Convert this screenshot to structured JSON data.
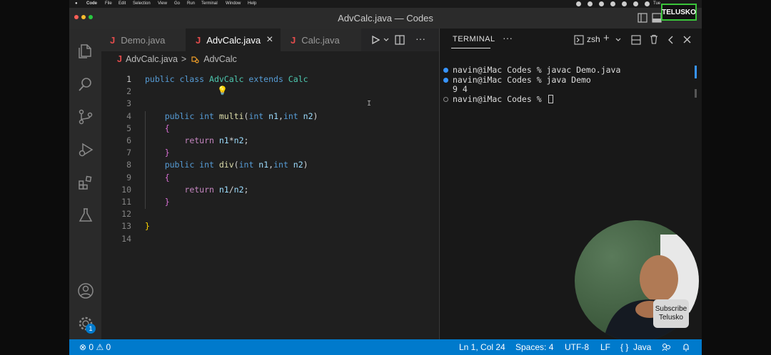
{
  "menubar": {
    "app": "Code",
    "items": [
      "File",
      "Edit",
      "Selection",
      "View",
      "Go",
      "Run",
      "Terminal",
      "Window",
      "Help"
    ],
    "clock": "Tue"
  },
  "window": {
    "title": "AdvCalc.java — Codes",
    "brand": "TELUSKO"
  },
  "tabs": [
    {
      "icon": "J",
      "label": "Demo.java",
      "active": false
    },
    {
      "icon": "J",
      "label": "AdvCalc.java",
      "active": true,
      "close": "×"
    },
    {
      "icon": "J",
      "label": "Calc.java",
      "active": false
    }
  ],
  "breadcrumb": {
    "file": "AdvCalc.java",
    "separator": ">",
    "symbol": "AdvCalc"
  },
  "code": {
    "line_numbers": [
      "1",
      "2",
      "3",
      "4",
      "5",
      "6",
      "7",
      "8",
      "9",
      "10",
      "11",
      "12",
      "13",
      "14"
    ],
    "lines": [
      [
        {
          "t": "public class ",
          "c": "kw"
        },
        {
          "t": "AdvCalc ",
          "c": "ty"
        },
        {
          "t": "extends ",
          "c": "kw"
        },
        {
          "t": "Calc",
          "c": "ty"
        }
      ],
      [],
      [],
      [
        {
          "t": "    "
        },
        {
          "t": "public int ",
          "c": "kw"
        },
        {
          "t": "multi",
          "c": "fn"
        },
        {
          "t": "("
        },
        {
          "t": "int ",
          "c": "kw"
        },
        {
          "t": "n1",
          "c": "vr"
        },
        {
          "t": ","
        },
        {
          "t": "int ",
          "c": "kw"
        },
        {
          "t": "n2",
          "c": "vr"
        },
        {
          "t": ")"
        }
      ],
      [
        {
          "t": "    "
        },
        {
          "t": "{",
          "c": "br2"
        }
      ],
      [
        {
          "t": "        "
        },
        {
          "t": "return ",
          "c": "ctl"
        },
        {
          "t": "n1",
          "c": "vr"
        },
        {
          "t": "*"
        },
        {
          "t": "n2",
          "c": "vr"
        },
        {
          "t": ";"
        }
      ],
      [
        {
          "t": "    "
        },
        {
          "t": "}",
          "c": "br2"
        }
      ],
      [
        {
          "t": "    "
        },
        {
          "t": "public int ",
          "c": "kw"
        },
        {
          "t": "div",
          "c": "fn"
        },
        {
          "t": "("
        },
        {
          "t": "int ",
          "c": "kw"
        },
        {
          "t": "n1",
          "c": "vr"
        },
        {
          "t": ","
        },
        {
          "t": "int ",
          "c": "kw"
        },
        {
          "t": "n2",
          "c": "vr"
        },
        {
          "t": ")"
        }
      ],
      [
        {
          "t": "    "
        },
        {
          "t": "{",
          "c": "br2"
        }
      ],
      [
        {
          "t": "        "
        },
        {
          "t": "return ",
          "c": "ctl"
        },
        {
          "t": "n1",
          "c": "vr"
        },
        {
          "t": "/"
        },
        {
          "t": "n2",
          "c": "vr"
        },
        {
          "t": ";"
        }
      ],
      [
        {
          "t": "    "
        },
        {
          "t": "}",
          "c": "br2"
        }
      ],
      [],
      [
        {
          "t": "}",
          "c": "br1"
        }
      ],
      []
    ]
  },
  "terminal": {
    "tab_label": "TERMINAL",
    "more": "···",
    "shell": "zsh",
    "lines": [
      {
        "marker": "fill",
        "text": "navin@iMac Codes % javac Demo.java"
      },
      {
        "marker": "fill",
        "text": "navin@iMac Codes % java Demo"
      },
      {
        "marker": "none",
        "text": "9 4"
      },
      {
        "marker": "empty",
        "text": "navin@iMac Codes % "
      }
    ]
  },
  "overlay": {
    "subscribe_line1": "Subscribe",
    "subscribe_line2": "Telusko"
  },
  "statusbar": {
    "errors": "0",
    "warnings": "0",
    "position": "Ln 1, Col 24",
    "spaces": "Spaces: 4",
    "encoding": "UTF-8",
    "eol": "LF",
    "braces": "{ }",
    "language": "Java"
  },
  "activity_badge": "1",
  "colors": {
    "accent": "#007acc",
    "java_icon": "#e34c4c",
    "brand_border": "#3ac43a"
  }
}
